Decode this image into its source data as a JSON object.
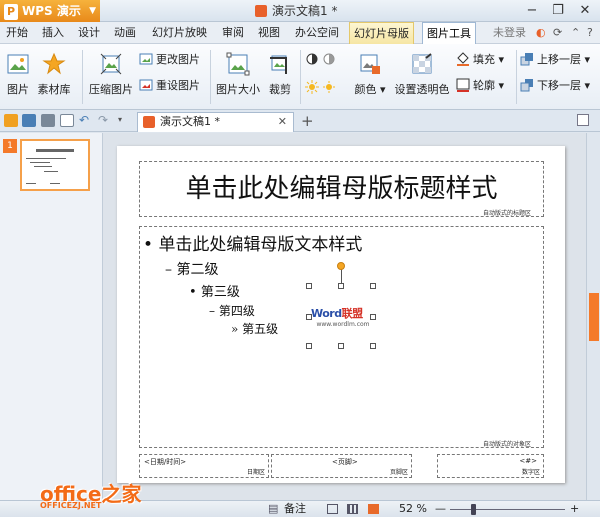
{
  "titlebar": {
    "app_name": "WPS 演示",
    "document_title": "演示文稿1 *",
    "minimize": "−",
    "restore": "❐",
    "close": "✕"
  },
  "menubar": {
    "items": [
      "开始",
      "插入",
      "设计",
      "动画",
      "幻灯片放映",
      "审阅",
      "视图",
      "办公空间",
      "幻灯片母版",
      "图片工具"
    ],
    "login": "未登录",
    "help": "?"
  },
  "ribbon": {
    "picture": "图片",
    "material": "素材库",
    "compress": "压缩图片",
    "change_picture": "更改图片",
    "reset_picture": "重设图片",
    "picture_size": "图片大小",
    "crop": "裁剪",
    "color": "颜色",
    "set_transparent": "设置透明色",
    "fill": "填充",
    "outline": "轮廓",
    "bring_forward": "上移一层",
    "send_backward": "下移一层"
  },
  "tabbar": {
    "doc_tab": "演示文稿1 *",
    "close": "✕",
    "add": "+"
  },
  "thumbnails": {
    "number": "1"
  },
  "slide": {
    "title": "单击此处编辑母版标题样式",
    "title_label": "自动版式的标题区",
    "level1": "单击此处编辑母版文本样式",
    "level2": "第二级",
    "level3": "第三级",
    "level4": "第四级",
    "level5": "第五级",
    "body_label": "自动版式的对象区",
    "date_text": "<日期/时间>",
    "date_label": "日期区",
    "footer_text": "<页脚>",
    "footer_label": "页脚区",
    "number_text": "<#>",
    "number_label": "数字区",
    "logo_word": "Word",
    "logo_cn": "联盟",
    "logo_url": "www.wordlm.com"
  },
  "statusbar": {
    "notes": "备注",
    "zoom": "52 %",
    "zoom_minus": "—",
    "zoom_plus": "+",
    "zoom_level": 0.2
  },
  "watermark": {
    "brand": "office",
    "brand_cn": "之家",
    "url": "OFFICEZJ.NET"
  },
  "colors": {
    "accent": "#f47a2a",
    "wps_orange": "#e8891a",
    "logo_blue": "#2a4fa8",
    "logo_red": "#d53227"
  }
}
